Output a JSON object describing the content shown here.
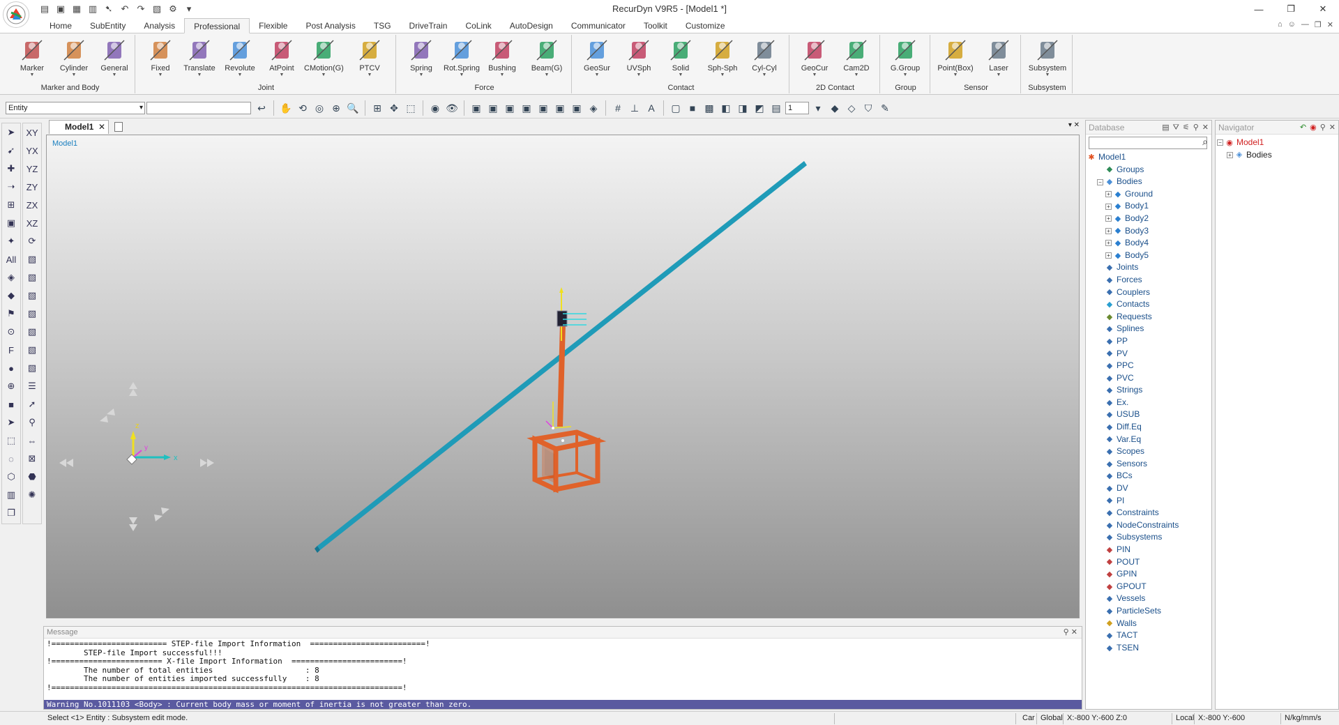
{
  "window": {
    "title": "RecurDyn V9R5  - [Model1 *]",
    "min": "—",
    "max": "❐",
    "close": "✕"
  },
  "ribbon_tabs": [
    "Home",
    "SubEntity",
    "Analysis",
    "Professional",
    "Flexible",
    "Post Analysis",
    "TSG",
    "DriveTrain",
    "CoLink",
    "AutoDesign",
    "Communicator",
    "Toolkit",
    "Customize"
  ],
  "ribbon_groups": {
    "marker_body": {
      "label": "Marker and Body",
      "buttons": [
        "Marker",
        "Cylinder",
        "General"
      ]
    },
    "joint": {
      "label": "Joint",
      "buttons": [
        "Fixed",
        "Translate",
        "Revolute",
        "AtPoint",
        "CMotion(G)",
        "PTCV"
      ]
    },
    "force": {
      "label": "Force",
      "buttons": [
        "Spring",
        "Rot.Spring",
        "Bushing",
        "Beam(G)"
      ]
    },
    "contact": {
      "label": "Contact",
      "buttons": [
        "GeoSur",
        "UVSph",
        "Solid",
        "Sph-Sph",
        "Cyl-Cyl"
      ]
    },
    "contact2d": {
      "label": "2D Contact",
      "buttons": [
        "GeoCur",
        "Cam2D"
      ]
    },
    "group": {
      "label": "Group",
      "buttons": [
        "G.Group"
      ]
    },
    "sensor": {
      "label": "Sensor",
      "buttons": [
        "Point(Box)",
        "Laser"
      ]
    },
    "subsystem": {
      "label": "Subsystem",
      "buttons": [
        "Subsystem"
      ]
    }
  },
  "toolbar": {
    "entity_value": "Entity",
    "view_number": "1"
  },
  "document": {
    "tab_label": "Model1",
    "viewport_label": "Model1",
    "axis_x": "x",
    "axis_y": "y",
    "axis_z": "z"
  },
  "message": {
    "title": "Message",
    "lines": [
      "!========================= STEP-file Import Information  =========================!",
      "        STEP-file Import successful!!!",
      "!======================== X-file Import Information  ========================!",
      "        The number of total entities                    : 8",
      "        The number of entities imported successfully    : 8",
      "!============================================================================!"
    ],
    "warning": "Warning No.1011103 <Body> : Current body mass or moment of inertia is not greater than zero."
  },
  "status": {
    "left": "Select <1> Entity : Subsystem edit mode.",
    "car": "Car",
    "global": "Global",
    "global_coords": "X:-800 Y:-600 Z:0",
    "local": "Local",
    "local_coords": "X:-800 Y:-600",
    "units": "N/kg/mm/s"
  },
  "database": {
    "title": "Database",
    "root": "Model1",
    "items": [
      {
        "label": "Groups",
        "indent": 1,
        "exp": false,
        "icon": "groups-icon",
        "color": "#2e8b57"
      },
      {
        "label": "Bodies",
        "indent": 1,
        "exp": true,
        "open": true,
        "icon": "bodies-icon",
        "color": "#4a8fd8"
      },
      {
        "label": "Ground",
        "indent": 2,
        "exp": true,
        "icon": "body-icon",
        "color": "#2a7fd0"
      },
      {
        "label": "Body1",
        "indent": 2,
        "exp": true,
        "icon": "body-icon",
        "color": "#2a7fd0"
      },
      {
        "label": "Body2",
        "indent": 2,
        "exp": true,
        "icon": "body-icon",
        "color": "#2a7fd0"
      },
      {
        "label": "Body3",
        "indent": 2,
        "exp": true,
        "icon": "body-icon",
        "color": "#2a7fd0"
      },
      {
        "label": "Body4",
        "indent": 2,
        "exp": true,
        "icon": "body-icon",
        "color": "#2a7fd0"
      },
      {
        "label": "Body5",
        "indent": 2,
        "exp": true,
        "icon": "body-icon",
        "color": "#2a7fd0"
      },
      {
        "label": "Joints",
        "indent": 1,
        "exp": false,
        "icon": "joints-icon",
        "color": "#3a6fb0"
      },
      {
        "label": "Forces",
        "indent": 1,
        "exp": false,
        "icon": "forces-icon",
        "color": "#3a6fb0"
      },
      {
        "label": "Couplers",
        "indent": 1,
        "exp": false,
        "icon": "couplers-icon",
        "color": "#3a6fb0"
      },
      {
        "label": "Contacts",
        "indent": 1,
        "exp": false,
        "icon": "contacts-icon",
        "color": "#2a9fd0"
      },
      {
        "label": "Requests",
        "indent": 1,
        "exp": false,
        "icon": "requests-icon",
        "color": "#6a8a30"
      },
      {
        "label": "Splines",
        "indent": 1,
        "exp": false,
        "icon": "splines-icon",
        "color": "#3a6fb0"
      },
      {
        "label": "PP",
        "indent": 1,
        "exp": false,
        "icon": "pp-icon",
        "color": "#3a6fb0"
      },
      {
        "label": "PV",
        "indent": 1,
        "exp": false,
        "icon": "pv-icon",
        "color": "#3a6fb0"
      },
      {
        "label": "PPC",
        "indent": 1,
        "exp": false,
        "icon": "ppc-icon",
        "color": "#3a6fb0"
      },
      {
        "label": "PVC",
        "indent": 1,
        "exp": false,
        "icon": "pvc-icon",
        "color": "#3a6fb0"
      },
      {
        "label": "Strings",
        "indent": 1,
        "exp": false,
        "icon": "strings-icon",
        "color": "#3a6fb0"
      },
      {
        "label": "Ex.",
        "indent": 1,
        "exp": false,
        "icon": "ex-icon",
        "color": "#3a6fb0"
      },
      {
        "label": "USUB",
        "indent": 1,
        "exp": false,
        "icon": "usub-icon",
        "color": "#3a6fb0"
      },
      {
        "label": "Diff.Eq",
        "indent": 1,
        "exp": false,
        "icon": "diffeq-icon",
        "color": "#3a6fb0"
      },
      {
        "label": "Var.Eq",
        "indent": 1,
        "exp": false,
        "icon": "vareq-icon",
        "color": "#3a6fb0"
      },
      {
        "label": "Scopes",
        "indent": 1,
        "exp": false,
        "icon": "scopes-icon",
        "color": "#3a6fb0"
      },
      {
        "label": "Sensors",
        "indent": 1,
        "exp": false,
        "icon": "sensors-icon",
        "color": "#3a6fb0"
      },
      {
        "label": "BCs",
        "indent": 1,
        "exp": false,
        "icon": "bcs-icon",
        "color": "#3a6fb0"
      },
      {
        "label": "DV",
        "indent": 1,
        "exp": false,
        "icon": "dv-icon",
        "color": "#3a6fb0"
      },
      {
        "label": "PI",
        "indent": 1,
        "exp": false,
        "icon": "pi-icon",
        "color": "#3a6fb0"
      },
      {
        "label": "Constraints",
        "indent": 1,
        "exp": false,
        "icon": "constraints-icon",
        "color": "#3a6fb0"
      },
      {
        "label": "NodeConstraints",
        "indent": 1,
        "exp": false,
        "icon": "nodeconstraints-icon",
        "color": "#3a6fb0"
      },
      {
        "label": "Subsystems",
        "indent": 1,
        "exp": false,
        "icon": "subsystems-icon",
        "color": "#3a6fb0"
      },
      {
        "label": "PIN",
        "indent": 1,
        "exp": false,
        "icon": "pin-icon",
        "color": "#c04040"
      },
      {
        "label": "POUT",
        "indent": 1,
        "exp": false,
        "icon": "pout-icon",
        "color": "#c04040"
      },
      {
        "label": "GPIN",
        "indent": 1,
        "exp": false,
        "icon": "gpin-icon",
        "color": "#c04040"
      },
      {
        "label": "GPOUT",
        "indent": 1,
        "exp": false,
        "icon": "gpout-icon",
        "color": "#c04040"
      },
      {
        "label": "Vessels",
        "indent": 1,
        "exp": false,
        "icon": "vessels-icon",
        "color": "#3a6fb0"
      },
      {
        "label": "ParticleSets",
        "indent": 1,
        "exp": false,
        "icon": "particlesets-icon",
        "color": "#3a6fb0"
      },
      {
        "label": "Walls",
        "indent": 1,
        "exp": false,
        "icon": "walls-icon",
        "color": "#d0a020"
      },
      {
        "label": "TACT",
        "indent": 1,
        "exp": false,
        "icon": "tact-icon",
        "color": "#3a6fb0"
      },
      {
        "label": "TSEN",
        "indent": 1,
        "exp": false,
        "icon": "tsen-icon",
        "color": "#3a6fb0"
      }
    ]
  },
  "navigator": {
    "title": "Navigator",
    "root": "Model1",
    "child": "Bodies"
  },
  "colors": {
    "beam": "#1f9bb8",
    "frame": "#e0622a",
    "accent": "#1a7fbf"
  }
}
